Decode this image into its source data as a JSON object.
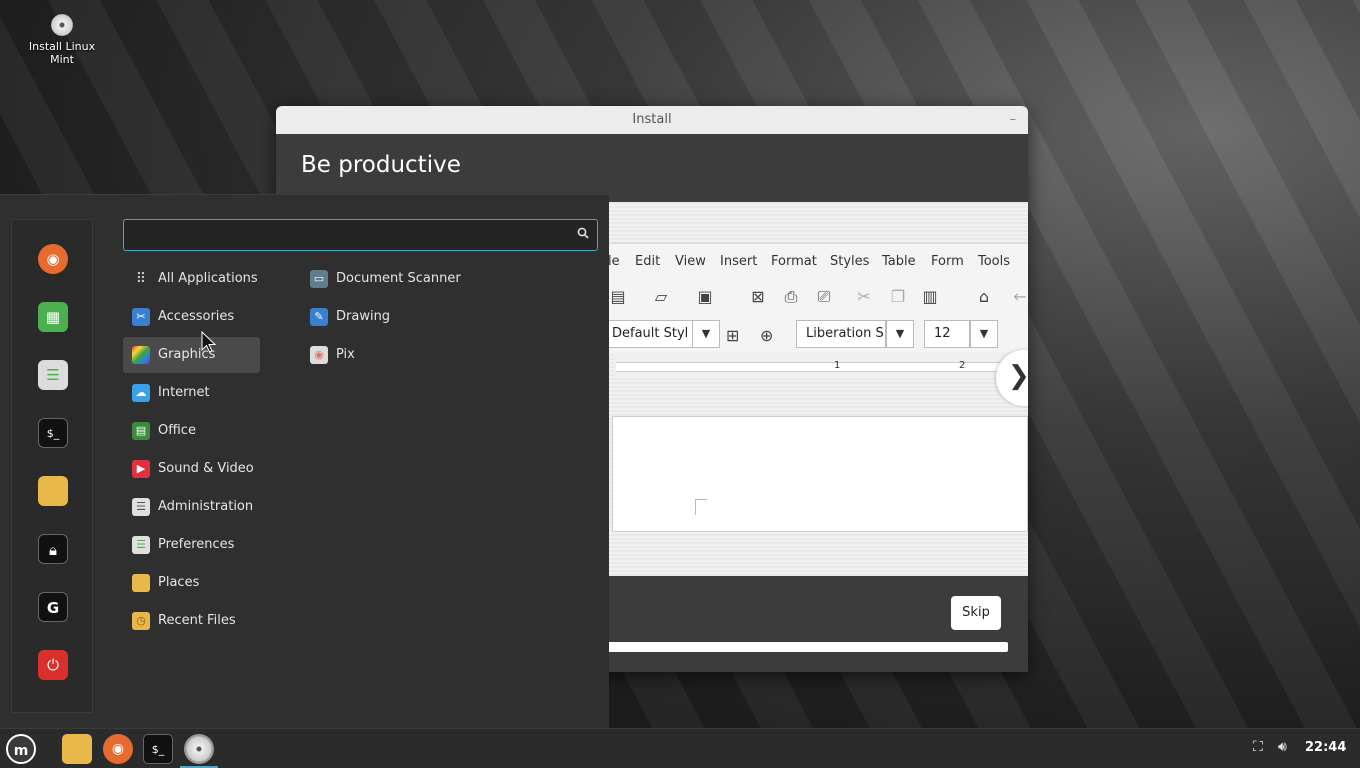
{
  "desktop": {
    "icon_label": "Install Linux Mint"
  },
  "installer": {
    "title": "Install",
    "minimize": "–",
    "heading": "Be productive",
    "skip_label": "Skip",
    "slide": {
      "menu": [
        "le",
        "Edit",
        "View",
        "Insert",
        "Format",
        "Styles",
        "Table",
        "Form",
        "Tools"
      ],
      "paragraph_style": "Default Styl",
      "font_name": "Liberation S",
      "font_size": "12",
      "ruler_numbers": [
        "1",
        "2"
      ],
      "next_arrow": "❯"
    }
  },
  "menu": {
    "search": {
      "value": "",
      "placeholder": ""
    },
    "categories": [
      {
        "label": "All Applications",
        "icon": "grid-icon"
      },
      {
        "label": "Accessories",
        "icon": "scissors-icon"
      },
      {
        "label": "Graphics",
        "icon": "graphics-icon",
        "selected": true
      },
      {
        "label": "Internet",
        "icon": "cloud-icon"
      },
      {
        "label": "Office",
        "icon": "office-icon"
      },
      {
        "label": "Sound & Video",
        "icon": "play-icon"
      },
      {
        "label": "Administration",
        "icon": "admin-icon"
      },
      {
        "label": "Preferences",
        "icon": "preferences-icon"
      },
      {
        "label": "Places",
        "icon": "folder-icon"
      },
      {
        "label": "Recent Files",
        "icon": "recent-files-icon"
      }
    ],
    "apps": [
      {
        "label": "Document Scanner",
        "icon": "scanner-icon"
      },
      {
        "label": "Drawing",
        "icon": "drawing-icon"
      },
      {
        "label": "Pix",
        "icon": "pix-icon"
      }
    ],
    "favorites": [
      "firefox-icon",
      "spreadsheet-icon",
      "settings-icon",
      "terminal-icon",
      "files-icon",
      "lock-icon",
      "logout-icon",
      "power-icon"
    ]
  },
  "taskbar": {
    "clock": "22:44",
    "apps": [
      "mint-menu-icon",
      "files-icon",
      "firefox-icon",
      "terminal-icon",
      "installer-disc-icon"
    ]
  },
  "colors": {
    "accent": "#4fa6c2",
    "firefox": "#e66b2e",
    "power": "#d9302c"
  }
}
